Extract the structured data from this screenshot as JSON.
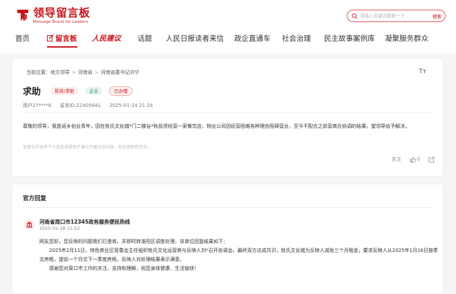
{
  "header": {
    "logo_title": "领导留言板",
    "logo_sub": "Message Board for Leaders",
    "search_placeholder": "请输入关键词搜索一下",
    "search_button": "搜索"
  },
  "nav": {
    "items": [
      "首页",
      "留言板",
      "人民建议",
      "话题",
      "人民日报读者来信",
      "政企直通车",
      "社会治理",
      "民主故事案例库",
      "凝聚服务群众"
    ]
  },
  "post": {
    "breadcrumb": [
      "当前位置：",
      "地方领导",
      "河南省",
      "河南省委书记刘宁"
    ],
    "font_size_icon_label": "Tт",
    "title": "求助",
    "tags": [
      "投诉/求助",
      "企业",
      "已办理"
    ],
    "user": "用户27****6",
    "message_id": "留言ID:22405641",
    "time": "2025-01-24 21:24",
    "content": "尊敬的领导，我是返乡创业青年，因在姓氏文化城*门二楼谷*秋投资经营一家餐饮店，物业公司因经营困难各种理由阻碍营业，至今不配合之前营商办协调的结果，望领导给予解决。",
    "notice": "该留言中含有个人信息或其他不便公开展示的内容，现办理机构可见。",
    "actions": {
      "follow": "关注",
      "like_count": "0"
    }
  },
  "reply": {
    "section_title": "官方回复",
    "org": "河南省周口市12345政务服务便民热线",
    "time": "2025-02-28 15:52",
    "paragraphs": [
      "网友您好，您反映的问题我们已查收，并即时转淮阳区调查处理，该单位回复结果如下：",
      "2025年2月11日，特色商业区管委会主任组织姓氏文化运营商与反映人刘*召开协调会。最终双方达成共识，姓氏文化城为反映人减免三个月租金，要求反映人从2025年1月16日按季交房租，提前一个月交下一季度房租，反映人对处理结果表示满意。",
      "感谢您对周口市工作的关注、支持和理解，祝您身体健康、生活愉快！"
    ]
  },
  "colors": {
    "brand_red": "#c8161d",
    "green": "#2f8e5c",
    "bg": "#f4f5f7"
  }
}
